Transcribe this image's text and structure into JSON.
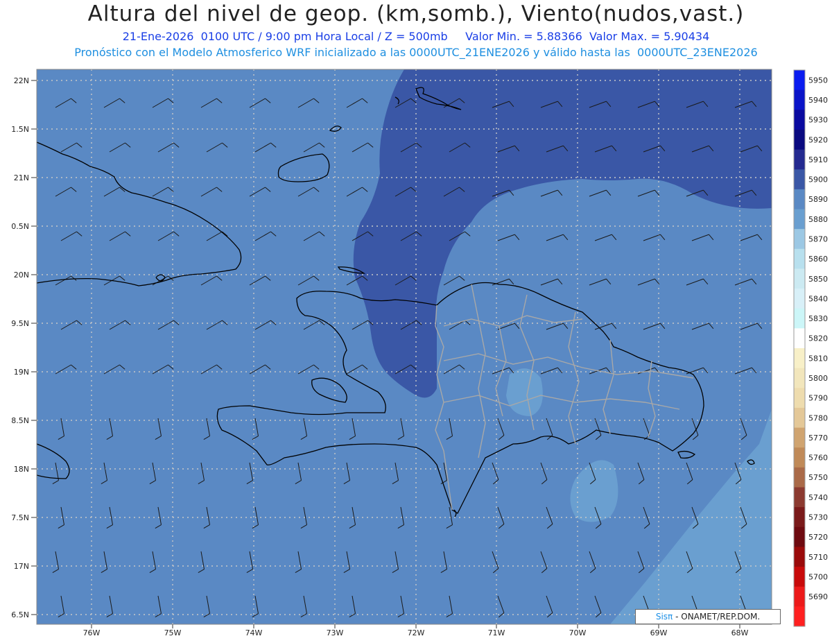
{
  "header": {
    "title": "Altura del nivel de geop. (km,somb.), Viento(nudos,vast.)",
    "subtitle_line1": "21-Ene-2026  0100 UTC / 9:00 pm Hora Local / Z = 500mb     Valor Min. = 5.88366  Valor Max. = 5.90434",
    "subtitle_line2": "Pronóstico con el Modelo Atmosferico WRF inicializado a las 0000UTC_21ENE2026 y válido hasta las  0000UTC_23ENE2026"
  },
  "map": {
    "lat_labels": [
      "22N",
      "1.5N",
      "21N",
      "0.5N",
      "20N",
      "9.5N",
      "19N",
      "8.5N",
      "18N",
      "7.5N",
      "17N",
      "6.5N"
    ],
    "lon_labels": [
      "76W",
      "75W",
      "74W",
      "73W",
      "72W",
      "71W",
      "70W",
      "69W",
      "68W"
    ],
    "colors": {
      "field_5890": "#5a89c4",
      "field_5900": "#3a57a6",
      "field_5880": "#6a9fd0",
      "coast": "#000000",
      "provinces": "#a8a8a8",
      "grid": "#c8c8c8"
    }
  },
  "colorbar": {
    "levels": [
      "5950",
      "5940",
      "5930",
      "5920",
      "5910",
      "5900",
      "5890",
      "5880",
      "5870",
      "5860",
      "5850",
      "5840",
      "5830",
      "5820",
      "5810",
      "5800",
      "5790",
      "5780",
      "5770",
      "5760",
      "5750",
      "5740",
      "5730",
      "5720",
      "5710",
      "5700",
      "5690"
    ],
    "colors": [
      "#0a1cf0",
      "#0a14c8",
      "#0a0aa0",
      "#0a0a80",
      "#242a90",
      "#3a57a6",
      "#5a89c4",
      "#6a9fd0",
      "#9cc8e4",
      "#b8e0ee",
      "#cceaf2",
      "#d8f0f8",
      "#ccf6f8",
      "#ffffff",
      "#f8f0c8",
      "#f2e6bc",
      "#eedcae",
      "#e4c898",
      "#d0a470",
      "#c08a58",
      "#aa6a48",
      "#8c3a30",
      "#7a1a1a",
      "#6e0a10",
      "#9a0a0a",
      "#c80a0a",
      "#ec1a1a",
      "#ff2020"
    ]
  },
  "credit": {
    "logo": "Sisπ",
    "text": "- ONAMET/REP.DOM."
  }
}
